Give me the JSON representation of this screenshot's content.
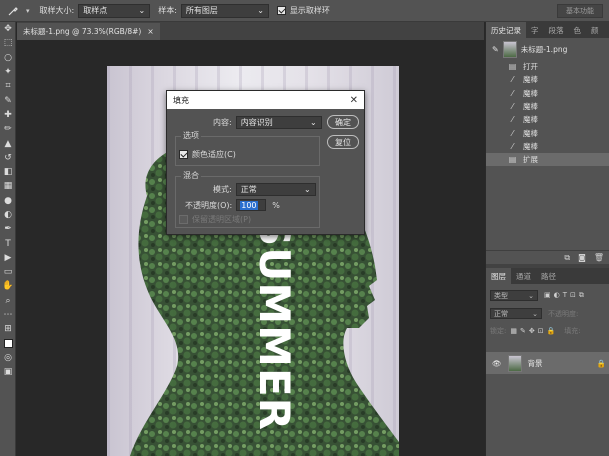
{
  "options_bar": {
    "sample_size_label": "取样大小:",
    "sample_size_value": "取样点",
    "sample_label": "样本:",
    "sample_value": "所有图层",
    "show_ring_label": "显示取样环",
    "workspace_label": "基本功能"
  },
  "document": {
    "tab_title": "未标题-1.png @ 73.3%(RGB/8#)",
    "close_glyph": "×",
    "canvas_text": "SUMMER"
  },
  "fill_dialog": {
    "title": "填充",
    "contents_label": "内容:",
    "contents_value": "内容识别",
    "ok_label": "确定",
    "cancel_label": "复位",
    "options_group_label": "选项",
    "color_adapt_label": "颜色适应(C)",
    "color_adapt_checked": true,
    "blending_group_label": "混合",
    "mode_label": "模式:",
    "mode_value": "正常",
    "opacity_label": "不透明度(O):",
    "opacity_value": "100",
    "opacity_unit": "%",
    "preserve_label": "保留透明区域(P)",
    "preserve_checked": false
  },
  "history_panel": {
    "tabs": [
      "历史记录",
      "字",
      "段落",
      "色",
      "颜"
    ],
    "snapshot_label": "未标题-1.png",
    "items": [
      {
        "label": "打开",
        "icon": "document-icon",
        "selected": false
      },
      {
        "label": "魔棒",
        "icon": "magic-wand-icon",
        "selected": false
      },
      {
        "label": "魔棒",
        "icon": "magic-wand-icon",
        "selected": false
      },
      {
        "label": "魔棒",
        "icon": "magic-wand-icon",
        "selected": false
      },
      {
        "label": "魔棒",
        "icon": "magic-wand-icon",
        "selected": false
      },
      {
        "label": "魔棒",
        "icon": "magic-wand-icon",
        "selected": false
      },
      {
        "label": "魔棒",
        "icon": "magic-wand-icon",
        "selected": false
      },
      {
        "label": "扩展",
        "icon": "document-icon",
        "selected": true
      }
    ]
  },
  "layers_panel": {
    "tabs": [
      "图层",
      "通道",
      "路径"
    ],
    "filter_label": "类型",
    "blend_mode": "正常",
    "opacity_label": "不透明度:",
    "lock_label": "锁定:",
    "fill_label": "填充:",
    "layer_name": "背景"
  }
}
